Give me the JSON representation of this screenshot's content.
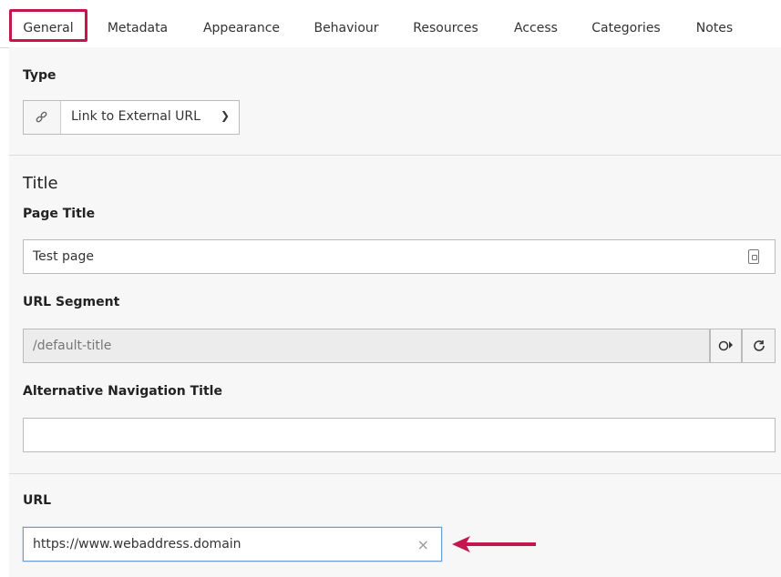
{
  "tabs": [
    {
      "label": "General",
      "active": true
    },
    {
      "label": "Metadata"
    },
    {
      "label": "Appearance"
    },
    {
      "label": "Behaviour"
    },
    {
      "label": "Resources"
    },
    {
      "label": "Access"
    },
    {
      "label": "Categories"
    },
    {
      "label": "Notes"
    }
  ],
  "type": {
    "label": "Type",
    "value": "Link to External URL",
    "icon": "link-icon"
  },
  "title_section": {
    "heading": "Title",
    "page_title_label": "Page Title",
    "page_title_value": "Test page",
    "url_segment_label": "URL Segment",
    "url_segment_value": "/default-title",
    "alt_nav_label": "Alternative Navigation Title",
    "alt_nav_value": ""
  },
  "url_section": {
    "label": "URL",
    "value": "https://www.webaddress.domain",
    "clear_glyph": "×"
  },
  "colors": {
    "active_tab_border": "#c5174e",
    "arrow": "#c5174e",
    "focus_border": "#6a9fd2"
  }
}
